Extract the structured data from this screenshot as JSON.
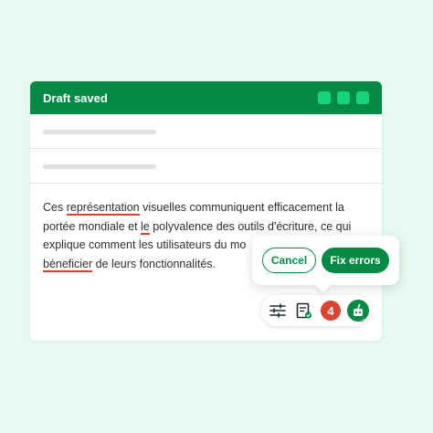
{
  "window": {
    "title": "Draft saved",
    "controls": 3
  },
  "text": {
    "s1": "Ces ",
    "e1": "représentation",
    "s2": " visuelles communiquent efficacement la portée mondiale et ",
    "e2": "le",
    "s3": " polyvalence des outils d'écriture, ce qui explique comment les utilisateurs du mo",
    "e3": "béneficier",
    "s4": " de leurs fonctionnalités."
  },
  "popup": {
    "cancel_label": "Cancel",
    "fix_label": "Fix errors"
  },
  "toolbar": {
    "error_count": "4"
  },
  "colors": {
    "brand": "#058a46",
    "accent": "#17d47a",
    "error": "#d9432f",
    "background": "#e6faf1"
  },
  "icons": [
    "sliders-icon",
    "document-check-icon",
    "grammarly-logo-icon"
  ]
}
